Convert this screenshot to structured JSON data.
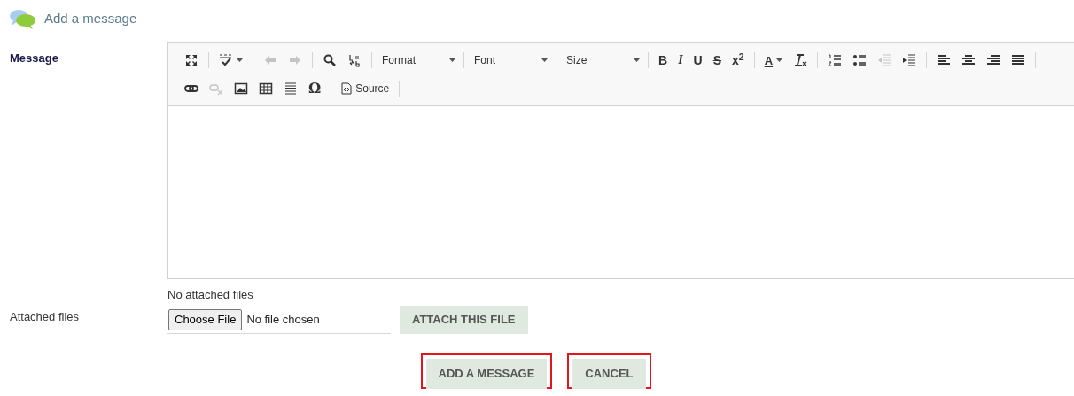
{
  "header": {
    "title": "Add a message"
  },
  "message": {
    "label": "Message",
    "toolbar": [
      [
        [
          {
            "kind": "maximize",
            "disabled": false
          }
        ],
        [
          {
            "kind": "spellcheck",
            "disabled": false
          }
        ],
        [
          {
            "kind": "undo",
            "disabled": true
          },
          {
            "kind": "redo",
            "disabled": true
          }
        ],
        [
          {
            "kind": "find",
            "disabled": false
          },
          {
            "kind": "replace",
            "disabled": false
          }
        ],
        [
          {
            "kind": "combo",
            "text": "Format",
            "disabled": false
          }
        ],
        [
          {
            "kind": "combo",
            "text": "Font",
            "disabled": false
          }
        ],
        [
          {
            "kind": "combo",
            "text": "Size",
            "disabled": false
          }
        ],
        [
          {
            "kind": "bold",
            "text": "B",
            "disabled": false
          },
          {
            "kind": "italic",
            "text": "I",
            "disabled": false
          },
          {
            "kind": "underline",
            "text": "U",
            "disabled": false
          },
          {
            "kind": "strike",
            "text": "S",
            "disabled": false
          },
          {
            "kind": "superscript",
            "text": "x$^{2}$",
            "disabled": false
          }
        ],
        [
          {
            "kind": "text-color",
            "text": "A",
            "disabled": false
          },
          {
            "kind": "remove-format",
            "disabled": false
          }
        ],
        [
          {
            "kind": "numbered-list",
            "disabled": false
          },
          {
            "kind": "bullet-list",
            "disabled": false
          },
          {
            "kind": "outdent",
            "disabled": true
          },
          {
            "kind": "indent",
            "disabled": false
          }
        ],
        [
          {
            "kind": "align-left",
            "disabled": false
          },
          {
            "kind": "align-center",
            "disabled": false
          },
          {
            "kind": "align-right",
            "disabled": false
          },
          {
            "kind": "justify",
            "disabled": false
          }
        ]
      ],
      [
        [
          {
            "kind": "link",
            "disabled": false
          },
          {
            "kind": "unlink",
            "disabled": true
          },
          {
            "kind": "image",
            "disabled": false
          },
          {
            "kind": "table",
            "disabled": false
          },
          {
            "kind": "horizontal-rule",
            "disabled": false
          },
          {
            "kind": "special-char",
            "text": "Ω",
            "disabled": false
          }
        ],
        [
          {
            "kind": "source",
            "text": "Source",
            "disabled": false
          }
        ]
      ]
    ]
  },
  "attachments": {
    "label": "Attached files",
    "status": "No attached files",
    "file_button": "Choose File",
    "file_status": "No file chosen",
    "attach_button": "ATTACH THIS FILE"
  },
  "actions": [
    {
      "label": "ADD A MESSAGE",
      "highlighted": true
    },
    {
      "label": "CANCEL",
      "highlighted": true
    }
  ]
}
